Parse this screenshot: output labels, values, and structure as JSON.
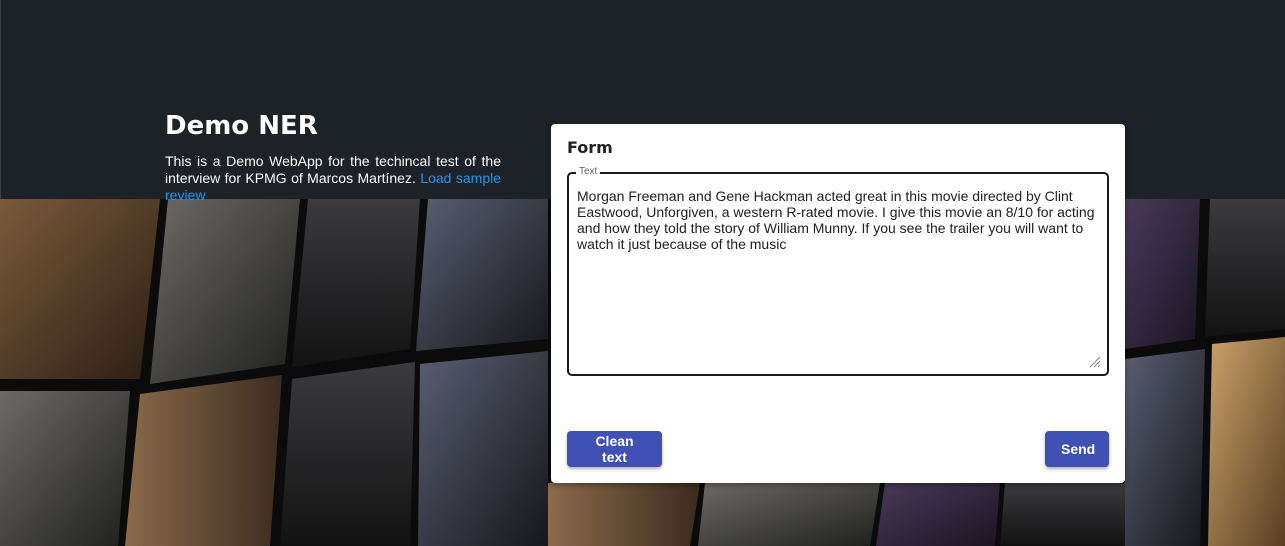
{
  "intro": {
    "title": "Demo NER",
    "description": "This is a Demo WebApp for the techincal test of the interview for KPMG of Marcos Martínez.",
    "load_sample_link": "Load sample review"
  },
  "form": {
    "title": "Form",
    "text_field": {
      "label": "Text",
      "value": "Morgan Freeman and Gene Hackman acted great in this movie directed by Clint Eastwood, Unforgiven, a western R-rated movie. I give this movie an 8/10 for acting and how they told the story of William Munny. If you see the trailer you will want to watch it just because of the music"
    },
    "clean_button": "Clean text",
    "send_button": "Send"
  },
  "colors": {
    "header_bg": "#1c2227",
    "link": "#2196f3",
    "button": "#3f51b5"
  },
  "icons": {
    "resize_handle": "resize-grip-icon"
  }
}
